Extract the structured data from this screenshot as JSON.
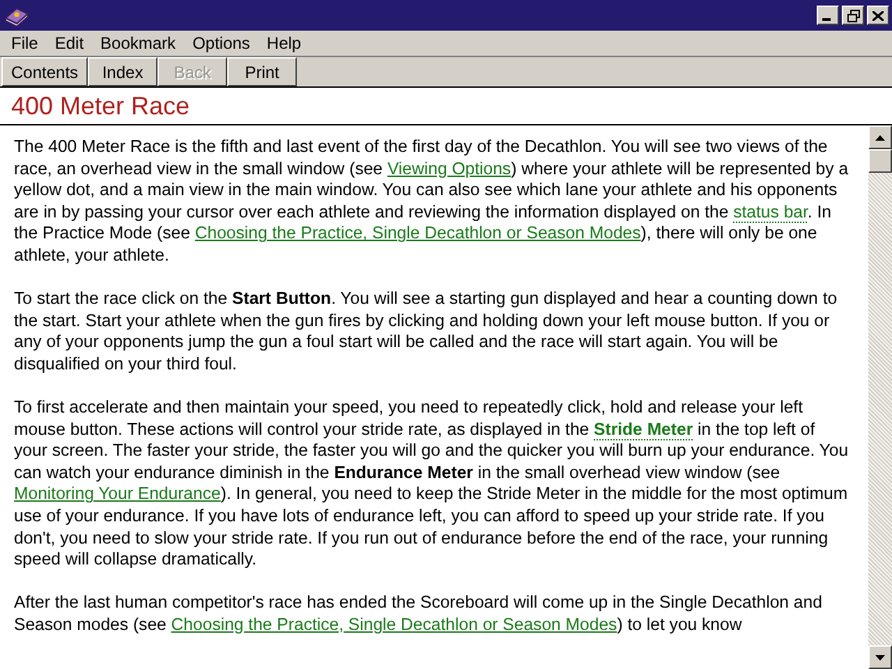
{
  "menu": [
    "File",
    "Edit",
    "Bookmark",
    "Options",
    "Help"
  ],
  "toolbar": [
    {
      "label": "Contents",
      "disabled": false
    },
    {
      "label": "Index",
      "disabled": false
    },
    {
      "label": "Back",
      "disabled": true
    },
    {
      "label": "Print",
      "disabled": false
    }
  ],
  "topic_title": "400 Meter Race",
  "paragraphs": [
    [
      {
        "kind": "text",
        "text": "The 400 Meter Race is the fifth and last event of the first day of the Decathlon.  You will see two views of the race, an overhead view in the small window (see "
      },
      {
        "kind": "link",
        "text": "Viewing Options"
      },
      {
        "kind": "text",
        "text": ") where your athlete will be represented by a yellow dot, and a main view in the main window.  You can also see which lane your athlete and his opponents are in by passing your cursor over each athlete and reviewing the information displayed on the "
      },
      {
        "kind": "popup",
        "text": "status bar"
      },
      {
        "kind": "text",
        "text": ".  In the Practice Mode (see "
      },
      {
        "kind": "link",
        "text": "Choosing the Practice, Single Decathlon or Season Modes"
      },
      {
        "kind": "text",
        "text": "), there will only be one athlete, your athlete."
      }
    ],
    [
      {
        "kind": "text",
        "text": "To start the race click on the **Start Button**.  You will see a starting gun displayed and hear a counting down to the start.  Start your athlete when the gun fires by clicking and holding down your left mouse button.  If you or any of your opponents jump the gun a foul start will be called and the race will start again.  You will be disqualified on your third foul."
      }
    ],
    [
      {
        "kind": "text",
        "text": "To first accelerate and then maintain your speed, you need to repeatedly click, hold and release your left mouse button.  These actions will control your stride rate, as displayed in the "
      },
      {
        "kind": "popup_bold",
        "text": "Stride Meter"
      },
      {
        "kind": "text",
        "text": " in the top left of your screen.  The faster your stride, the faster you will go and the quicker you will burn up your endurance.  You can watch your endurance diminish in the **Endurance Meter** in the small overhead view window (see "
      },
      {
        "kind": "link",
        "text": "Monitoring Your Endurance"
      },
      {
        "kind": "text",
        "text": ").  In general, you need to keep the Stride Meter in the middle for the most optimum use of your endurance.  If you have lots of endurance left, you can afford to speed up your stride rate.  If you don't, you need to slow your stride rate.  If you run out of endurance before the end of the race, your running speed will collapse dramatically."
      }
    ],
    [
      {
        "kind": "text",
        "text": "After the last human competitor's race has ended the Scoreboard will come up in the Single Decathlon and Season modes (see "
      },
      {
        "kind": "link",
        "text": "Choosing the Practice, Single Decathlon or Season Modes"
      },
      {
        "kind": "text",
        "text": ") to let you know"
      }
    ]
  ]
}
